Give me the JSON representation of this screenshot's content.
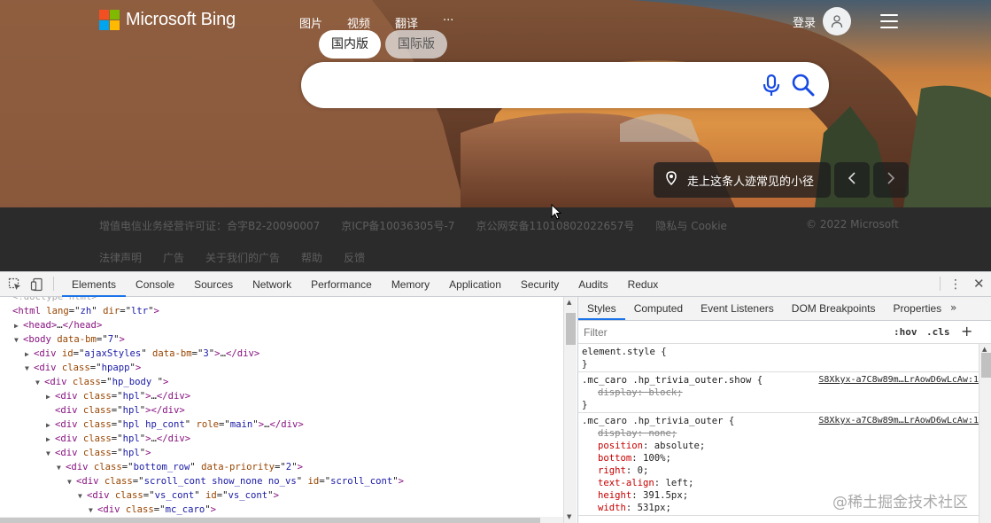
{
  "bing": {
    "logo_text": "Microsoft Bing",
    "nav": [
      "图片",
      "视频",
      "翻译",
      "···"
    ],
    "login_label": "登录",
    "region_tabs": [
      {
        "label": "国内版",
        "active": true
      },
      {
        "label": "国际版",
        "active": false
      }
    ],
    "search": {
      "value": "",
      "placeholder": ""
    },
    "trivia_text": "走上这条人迹常见的小径",
    "footer_row1": [
      "增值电信业务经营许可证：合字B2-20090007",
      "京ICP备10036305号-7",
      "京公网安备11010802022657号",
      "隐私与 Cookie"
    ],
    "copyright": "© 2022 Microsoft",
    "footer_row2": [
      "法律声明",
      "广告",
      "关于我们的广告",
      "帮助",
      "反馈"
    ],
    "colors": {
      "logo_red": "#f25022",
      "logo_green": "#7fba00",
      "logo_blue": "#00a4ef",
      "logo_yellow": "#ffb900",
      "footer_bg": "#2b2b2b",
      "mic_blue": "#174ae4"
    }
  },
  "devtools": {
    "tabs": [
      "Elements",
      "Console",
      "Sources",
      "Network",
      "Performance",
      "Memory",
      "Application",
      "Security",
      "Audits",
      "Redux"
    ],
    "active_tab": "Elements",
    "dom_lines": [
      {
        "indent": 0,
        "toggle": "",
        "parts": [
          [
            "comment",
            "<!doctype html>"
          ]
        ]
      },
      {
        "indent": 0,
        "toggle": "",
        "parts": [
          [
            "tag",
            "<html"
          ],
          [
            "attr",
            " lang"
          ],
          [
            "txt",
            "=\""
          ],
          [
            "val",
            "zh"
          ],
          [
            "txt",
            "\""
          ],
          [
            "attr",
            " dir"
          ],
          [
            "txt",
            "=\""
          ],
          [
            "val",
            "ltr"
          ],
          [
            "txt",
            "\""
          ],
          [
            "tag",
            ">"
          ]
        ]
      },
      {
        "indent": 1,
        "toggle": "▶",
        "parts": [
          [
            "tag",
            "<head>"
          ],
          [
            "txt",
            "…"
          ],
          [
            "tag",
            "</head>"
          ]
        ]
      },
      {
        "indent": 1,
        "toggle": "▼",
        "parts": [
          [
            "tag",
            "<body"
          ],
          [
            "attr",
            " data-bm"
          ],
          [
            "txt",
            "=\""
          ],
          [
            "val",
            "7"
          ],
          [
            "txt",
            "\""
          ],
          [
            "tag",
            ">"
          ]
        ]
      },
      {
        "indent": 2,
        "toggle": "▶",
        "parts": [
          [
            "tag",
            "<div"
          ],
          [
            "attr",
            " id"
          ],
          [
            "txt",
            "=\""
          ],
          [
            "val",
            "ajaxStyles"
          ],
          [
            "txt",
            "\""
          ],
          [
            "attr",
            " data-bm"
          ],
          [
            "txt",
            "=\""
          ],
          [
            "val",
            "3"
          ],
          [
            "txt",
            "\""
          ],
          [
            "tag",
            ">"
          ],
          [
            "txt",
            "…"
          ],
          [
            "tag",
            "</div>"
          ]
        ]
      },
      {
        "indent": 2,
        "toggle": "▼",
        "parts": [
          [
            "tag",
            "<div"
          ],
          [
            "attr",
            " class"
          ],
          [
            "txt",
            "=\""
          ],
          [
            "val",
            "hpapp"
          ],
          [
            "txt",
            "\""
          ],
          [
            "tag",
            ">"
          ]
        ]
      },
      {
        "indent": 3,
        "toggle": "▼",
        "parts": [
          [
            "tag",
            "<div"
          ],
          [
            "attr",
            " class"
          ],
          [
            "txt",
            "=\""
          ],
          [
            "val",
            "hp_body  "
          ],
          [
            "txt",
            "\""
          ],
          [
            "tag",
            ">"
          ]
        ]
      },
      {
        "indent": 4,
        "toggle": "▶",
        "parts": [
          [
            "tag",
            "<div"
          ],
          [
            "attr",
            " class"
          ],
          [
            "txt",
            "=\""
          ],
          [
            "val",
            "hpl"
          ],
          [
            "txt",
            "\""
          ],
          [
            "tag",
            ">"
          ],
          [
            "txt",
            "…"
          ],
          [
            "tag",
            "</div>"
          ]
        ]
      },
      {
        "indent": 4,
        "toggle": "",
        "parts": [
          [
            "tag",
            "<div"
          ],
          [
            "attr",
            " class"
          ],
          [
            "txt",
            "=\""
          ],
          [
            "val",
            "hpl"
          ],
          [
            "txt",
            "\""
          ],
          [
            "tag",
            "></div>"
          ]
        ]
      },
      {
        "indent": 4,
        "toggle": "▶",
        "parts": [
          [
            "tag",
            "<div"
          ],
          [
            "attr",
            " class"
          ],
          [
            "txt",
            "=\""
          ],
          [
            "val",
            "hpl hp_cont"
          ],
          [
            "txt",
            "\""
          ],
          [
            "attr",
            " role"
          ],
          [
            "txt",
            "=\""
          ],
          [
            "val",
            "main"
          ],
          [
            "txt",
            "\""
          ],
          [
            "tag",
            ">"
          ],
          [
            "txt",
            "…"
          ],
          [
            "tag",
            "</div>"
          ]
        ]
      },
      {
        "indent": 4,
        "toggle": "▶",
        "parts": [
          [
            "tag",
            "<div"
          ],
          [
            "attr",
            " class"
          ],
          [
            "txt",
            "=\""
          ],
          [
            "val",
            "hpl"
          ],
          [
            "txt",
            "\""
          ],
          [
            "tag",
            ">"
          ],
          [
            "txt",
            "…"
          ],
          [
            "tag",
            "</div>"
          ]
        ]
      },
      {
        "indent": 4,
        "toggle": "▼",
        "parts": [
          [
            "tag",
            "<div"
          ],
          [
            "attr",
            " class"
          ],
          [
            "txt",
            "=\""
          ],
          [
            "val",
            "hpl"
          ],
          [
            "txt",
            "\""
          ],
          [
            "tag",
            ">"
          ]
        ]
      },
      {
        "indent": 5,
        "toggle": "▼",
        "parts": [
          [
            "tag",
            "<div"
          ],
          [
            "attr",
            " class"
          ],
          [
            "txt",
            "=\""
          ],
          [
            "val",
            "bottom_row"
          ],
          [
            "txt",
            "\""
          ],
          [
            "attr",
            " data-priority"
          ],
          [
            "txt",
            "=\""
          ],
          [
            "val",
            "2"
          ],
          [
            "txt",
            "\""
          ],
          [
            "tag",
            ">"
          ]
        ]
      },
      {
        "indent": 6,
        "toggle": "▼",
        "parts": [
          [
            "tag",
            "<div"
          ],
          [
            "attr",
            " class"
          ],
          [
            "txt",
            "=\""
          ],
          [
            "val",
            "scroll_cont show_none no_vs"
          ],
          [
            "txt",
            "\""
          ],
          [
            "attr",
            " id"
          ],
          [
            "txt",
            "=\""
          ],
          [
            "val",
            "scroll_cont"
          ],
          [
            "txt",
            "\""
          ],
          [
            "tag",
            ">"
          ]
        ]
      },
      {
        "indent": 7,
        "toggle": "▼",
        "parts": [
          [
            "tag",
            "<div"
          ],
          [
            "attr",
            " class"
          ],
          [
            "txt",
            "=\""
          ],
          [
            "val",
            "vs_cont"
          ],
          [
            "txt",
            "\""
          ],
          [
            "attr",
            " id"
          ],
          [
            "txt",
            "=\""
          ],
          [
            "val",
            "vs_cont"
          ],
          [
            "txt",
            "\""
          ],
          [
            "tag",
            ">"
          ]
        ]
      },
      {
        "indent": 8,
        "toggle": "▼",
        "parts": [
          [
            "tag",
            "<div"
          ],
          [
            "attr",
            " class"
          ],
          [
            "txt",
            "=\""
          ],
          [
            "val",
            "mc_caro"
          ],
          [
            "txt",
            "\""
          ],
          [
            "tag",
            ">"
          ]
        ]
      }
    ],
    "styles_tabs": [
      "Styles",
      "Computed",
      "Event Listeners",
      "DOM Breakpoints",
      "Properties"
    ],
    "styles_more": "»",
    "filter_placeholder": "Filter",
    "hov_label": ":hov",
    "cls_label": ".cls",
    "add_label": "+",
    "rules": [
      {
        "selector": "element.style {",
        "source": "",
        "props": [],
        "close": "}"
      },
      {
        "selector": ".mc_caro .hp_trivia_outer.show {",
        "source": "S8Xkyx-a7C8w89m…LrAowD6wLcAw:1",
        "props": [
          {
            "name": "display",
            "value": "block;",
            "struck": true
          }
        ],
        "close": "}"
      },
      {
        "selector": ".mc_caro .hp_trivia_outer {",
        "source": "S8Xkyx-a7C8w89m…LrAowD6wLcAw:1",
        "props": [
          {
            "name": "display",
            "value": "none;",
            "struck": true
          },
          {
            "name": "position",
            "value": "absolute;",
            "struck": false
          },
          {
            "name": "bottom",
            "value": "100%;",
            "struck": false
          },
          {
            "name": "right",
            "value": "0;",
            "struck": false
          },
          {
            "name": "text-align",
            "value": "left;",
            "struck": false
          },
          {
            "name": "height",
            "value": "391.5px;",
            "struck": false
          },
          {
            "name": "width",
            "value": "531px;",
            "struck": false
          }
        ],
        "close": ""
      }
    ]
  },
  "watermark": "@稀土掘金技术社区"
}
